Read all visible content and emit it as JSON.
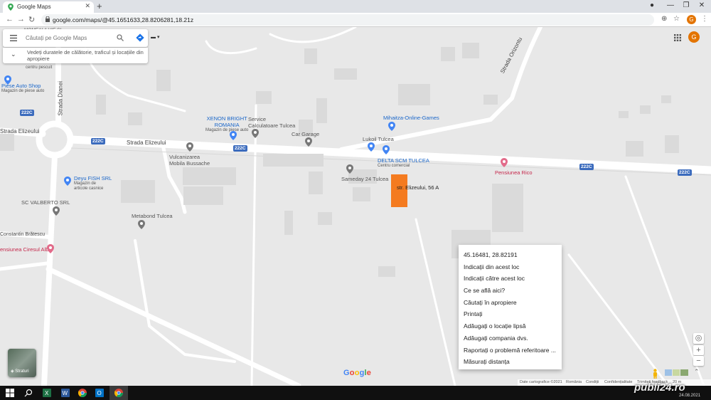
{
  "browser": {
    "tab_title": "Google Maps",
    "tab_close": "✕",
    "new_tab": "+",
    "url": "google.com/maps/@45.1651633,28.8206281,18.21z",
    "profile_initial": "G"
  },
  "search": {
    "placeholder": "Căutați pe Google Maps",
    "travel_info": "Vedeți duratele de călătorie, traficul și locațiile din apropiere"
  },
  "roads": {
    "strada_elizeului": "Strada Elizeului",
    "strada_elizeului_left": "Strada Elizeului",
    "strada_orizontului": "Strada Orizontu",
    "strada_dianei": "Strada Dianei",
    "constantin_bratescu": "Constantin Brătescu",
    "route_222c": "222C"
  },
  "pois": {
    "momeala": "MOMEALA VIE ȘI",
    "pescuit": "centru pescuit",
    "piese_auto": "Piese Auto Shop",
    "piese_auto_sub": "Magazin de piese auto",
    "xenon_1": "XENON BRIGHT",
    "xenon_2": "ROMANIA",
    "xenon_sub": "Magazin de piese auto",
    "service_1": "Service",
    "service_2": "Calculatoare Tulcea",
    "car_garage": "Car Garage",
    "mihaitza": "Mihaitza-Online-Games",
    "lukoil": "Lukoil Tulcea",
    "delta": "DELTA SCM TULCEA",
    "delta_sub": "Centru comercial",
    "pensiunea_rico": "Pensiunea Rico",
    "sameday": "Sameday 24 Tulcea",
    "vulcanizarea_1": "Vulcanizarea",
    "vulcanizarea_2": "Mobila Bussache",
    "deyu": "Deyu FISH SRL",
    "deyu_sub_1": "Magazin de",
    "deyu_sub_2": "articole casnice",
    "valberto": "SC VALBERTO SRL",
    "metabond": "Metabond Tulcea",
    "ciresul": "ensiunea Ciresul Alb",
    "address": "str. Elizeului, 56 A"
  },
  "context_menu": [
    "45.16481, 28.82191",
    "Indicații din acest loc",
    "Indicații către acest loc",
    "Ce se află aici?",
    "Căutați în apropiere",
    "Printați",
    "Adăugați o locație lipsă",
    "Adăugați compania dvs.",
    "Raportați o problemă referitoare ...",
    "Măsurați distanța"
  ],
  "layers_label": "Straturi",
  "google_logo": "Google",
  "controls": {
    "zoom_in": "+",
    "zoom_out": "−",
    "locate": "◎"
  },
  "footer": {
    "map_data": "Date cartografice ©2021",
    "romania": "România",
    "terms": "Condiții",
    "privacy": "Confidențialitate",
    "feedback": "Trimiteți feedback",
    "scale": "20 m"
  },
  "watermark": {
    "text": "publi24.ro",
    "date": "24.08.2021"
  },
  "colors": {
    "accent_orange": "#f47b20",
    "poi_blue": "#1a66c9",
    "poi_pink": "#c5284b",
    "route_shield": "#3b6bbd"
  }
}
